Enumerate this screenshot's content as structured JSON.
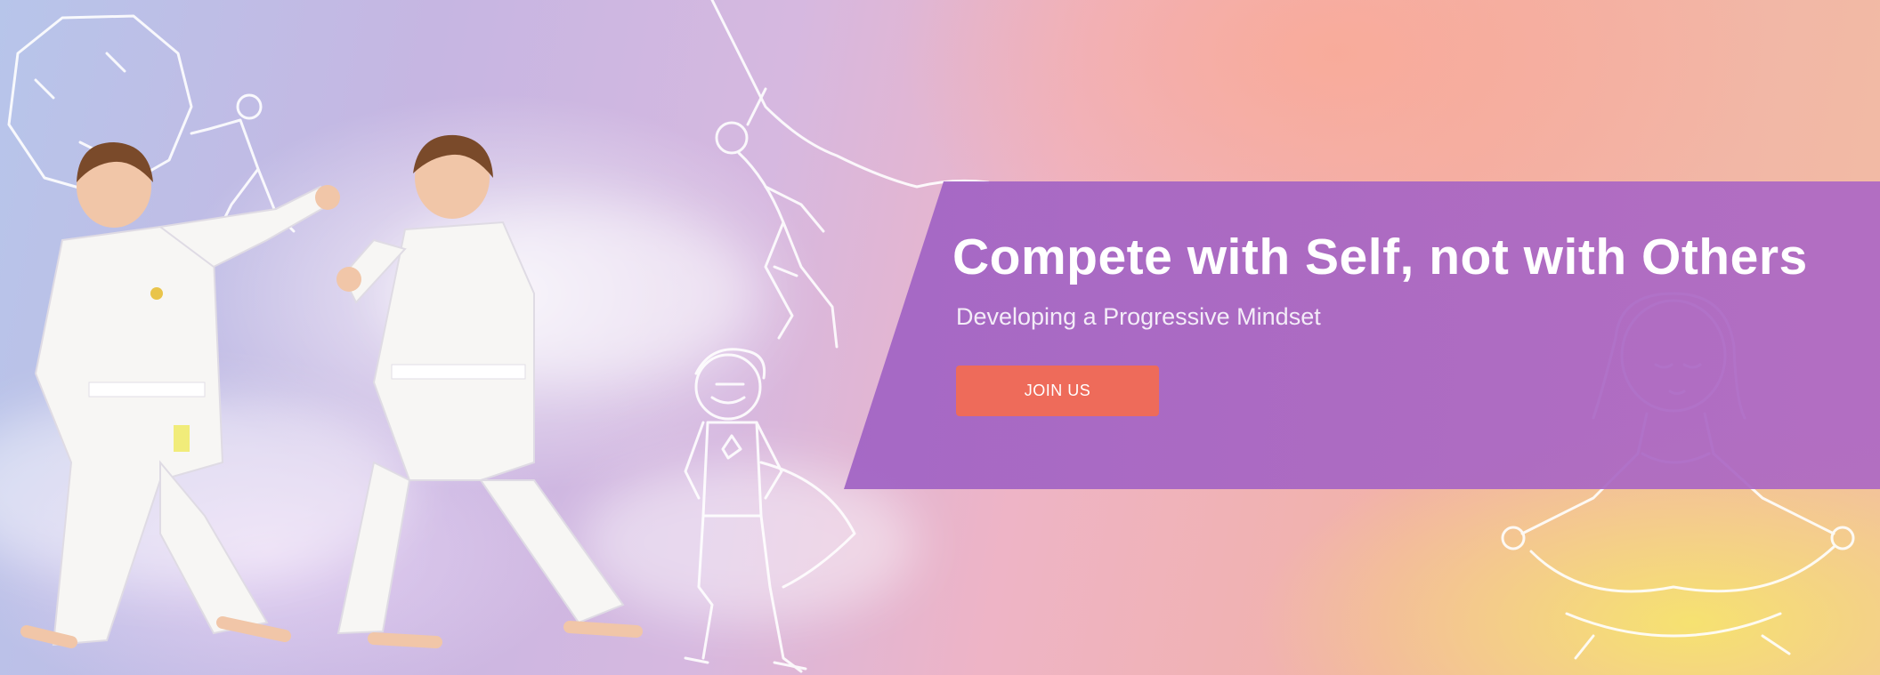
{
  "hero": {
    "headline": "Compete with Self, not with Others",
    "subheadline": "Developing a Progressive Mindset",
    "cta_label": "JOIN US"
  },
  "colors": {
    "banner": "#a862c4",
    "cta": "#ee6b5a",
    "sky_blue": "#b7c5ea",
    "sky_pink": "#f2b1a8",
    "glow_yellow": "#f6e46e"
  },
  "illustrations": [
    "karate-kids-photo",
    "boulder-sketch",
    "climber-sketch",
    "superhero-boy-sketch",
    "meditating-girl-sketch"
  ]
}
